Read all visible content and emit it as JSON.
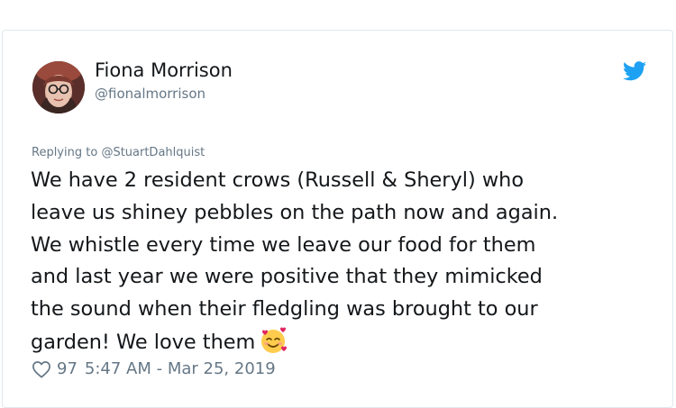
{
  "tweet": {
    "author_name": "Fiona Morrison",
    "author_handle": "@fionalmorrison",
    "reply_label": "Replying to ",
    "reply_handle": "@StuartDahlquist",
    "text_lines": [
      "We have 2 resident crows (Russell & Sheryl) who",
      "leave us shiney pebbles on the path now and again.",
      "We whistle every time we leave our food for them",
      "and last year we were positive that they mimicked",
      "the sound when their fledgling was brought to our",
      "garden! We love them"
    ],
    "like_count": "97",
    "timestamp": "5:47 AM - Mar 25, 2019"
  },
  "icons": {
    "brand": "twitter-bird-icon",
    "emoji": "smiling-face-with-hearts-emoji",
    "like": "heart-outline-icon"
  },
  "colors": {
    "brand": "#1da1f2",
    "text": "#14171a",
    "muted": "#657786",
    "border": "#e1e8ed"
  }
}
